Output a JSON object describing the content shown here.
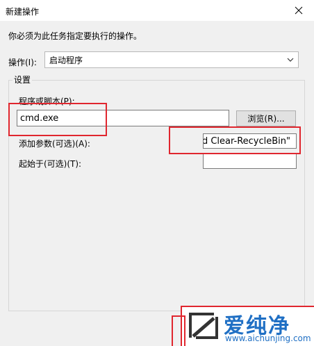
{
  "window": {
    "title": "新建操作"
  },
  "instruction": "你必须为此任务指定要执行的操作。",
  "action": {
    "label": "操作(I):",
    "value": "启动程序"
  },
  "group": {
    "title": "设置",
    "program_label": "程序或脚本(P):",
    "program_value": "cmd.exe",
    "browse_label": "浏览(R)...",
    "args_label": "添加参数(可选)(A):",
    "args_value": "nd Clear-RecycleBin\"",
    "start_label": "起始于(可选)(T):",
    "start_value": ""
  },
  "watermark": {
    "brand": "爱纯净",
    "url": "www.aichunjing.com"
  },
  "colors": {
    "highlight": "#e0262e",
    "brand": "#1f6fc4"
  }
}
